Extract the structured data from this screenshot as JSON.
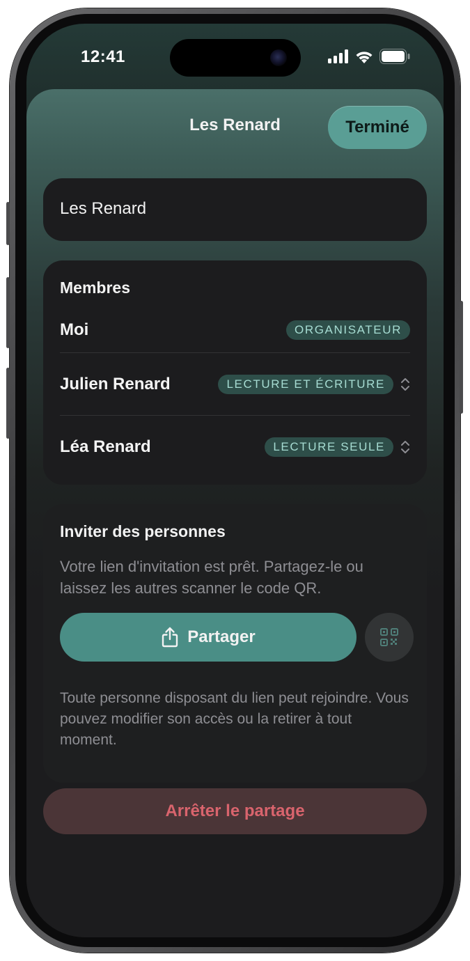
{
  "status_bar": {
    "time": "12:41",
    "icons": [
      "cellular-signal-icon",
      "wifi-icon",
      "battery-icon"
    ]
  },
  "sheet": {
    "title": "Les Renard",
    "done_label": "Terminé"
  },
  "group_name": {
    "value": "Les Renard"
  },
  "members": {
    "section_label": "Membres",
    "items": [
      {
        "name": "Moi",
        "role": "ORGANISATEUR",
        "changeable": false
      },
      {
        "name": "Julien Renard",
        "role": "LECTURE ET ÉCRITURE",
        "changeable": true
      },
      {
        "name": "Léa Renard",
        "role": "LECTURE SEULE",
        "changeable": true
      }
    ]
  },
  "invite": {
    "title": "Inviter des personnes",
    "description": "Votre lien d'invitation est prêt. Partagez-le ou laissez les autres scanner le code QR.",
    "share_label": "Partager",
    "note": "Toute personne disposant du lien peut rejoindre. Vous pouvez modifier son accès ou la retirer à tout moment."
  },
  "stop_sharing": {
    "label": "Arrêter le partage"
  },
  "colors": {
    "accent": "#4a8e86",
    "done_button": "#5a9e95",
    "badge_bg": "#2e4e49",
    "badge_text": "#a6dcd2",
    "destructive_text": "#d9646d",
    "destructive_bg": "#4b3537",
    "card_bg": "#1c1c1e"
  }
}
